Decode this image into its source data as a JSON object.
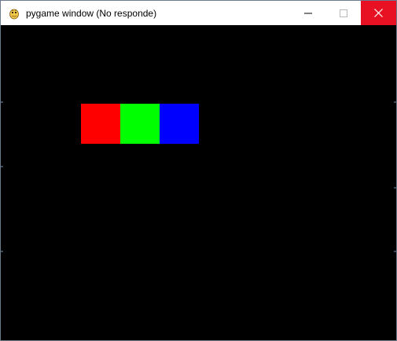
{
  "window": {
    "title": "pygame window (No responde)",
    "icon": "pygame-snake-icon"
  },
  "controls": {
    "minimize_icon": "minimize-icon",
    "maximize_icon": "maximize-icon",
    "close_icon": "close-icon",
    "close_color": "#e81123"
  },
  "canvas": {
    "background": "#000000",
    "blocks": [
      {
        "name": "red-block",
        "color": "#ff0000"
      },
      {
        "name": "green-block",
        "color": "#00ff00"
      },
      {
        "name": "blue-block",
        "color": "#0000ff"
      }
    ]
  }
}
